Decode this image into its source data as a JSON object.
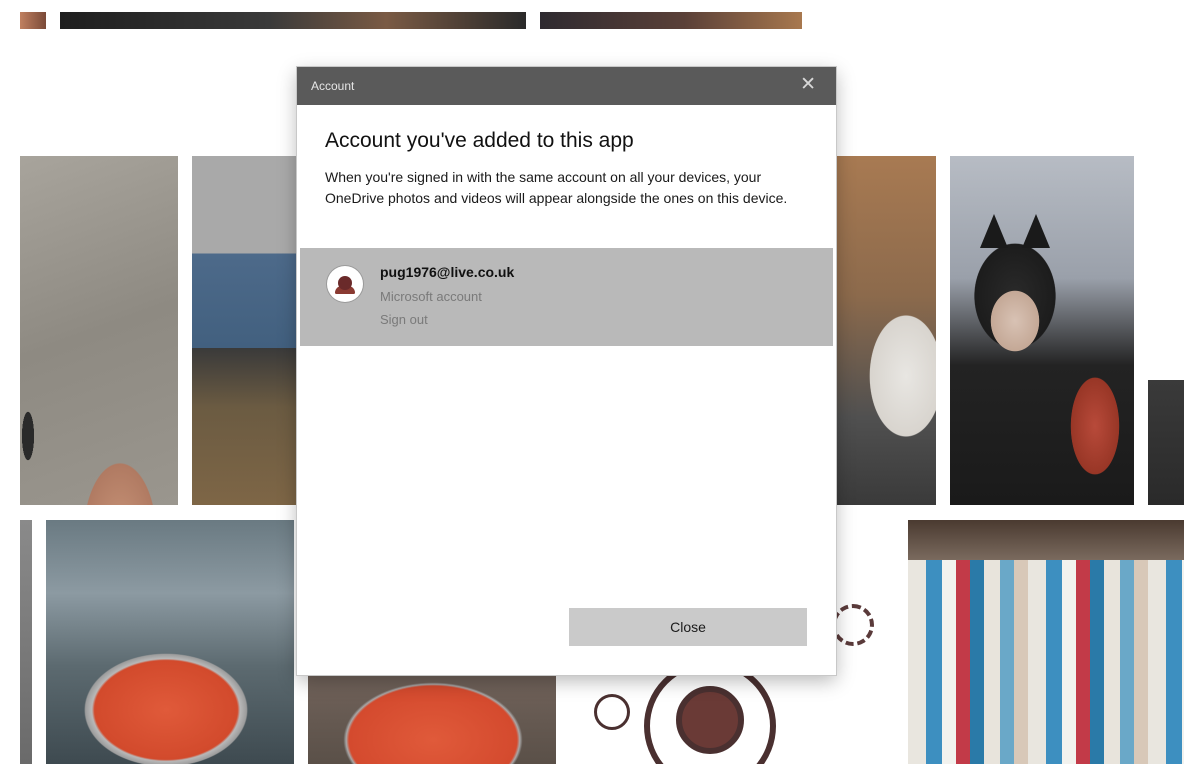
{
  "dialog": {
    "title": "Account",
    "close_icon": "✕",
    "heading": "Account you've added to this app",
    "description": "When you're signed in with the same account on all your devices, your OneDrive photos and videos will appear alongside the ones on this device.",
    "account": {
      "email": "pug1976@live.co.uk",
      "type": "Microsoft account",
      "sign_out_label": "Sign out"
    },
    "close_button_label": "Close"
  },
  "icons": {
    "dialog_close": "close-icon",
    "account_avatar": "avatar"
  },
  "colors": {
    "titlebar": "#5a5a5a",
    "account_row": "#b9b9b9",
    "close_button": "#cacaca"
  }
}
